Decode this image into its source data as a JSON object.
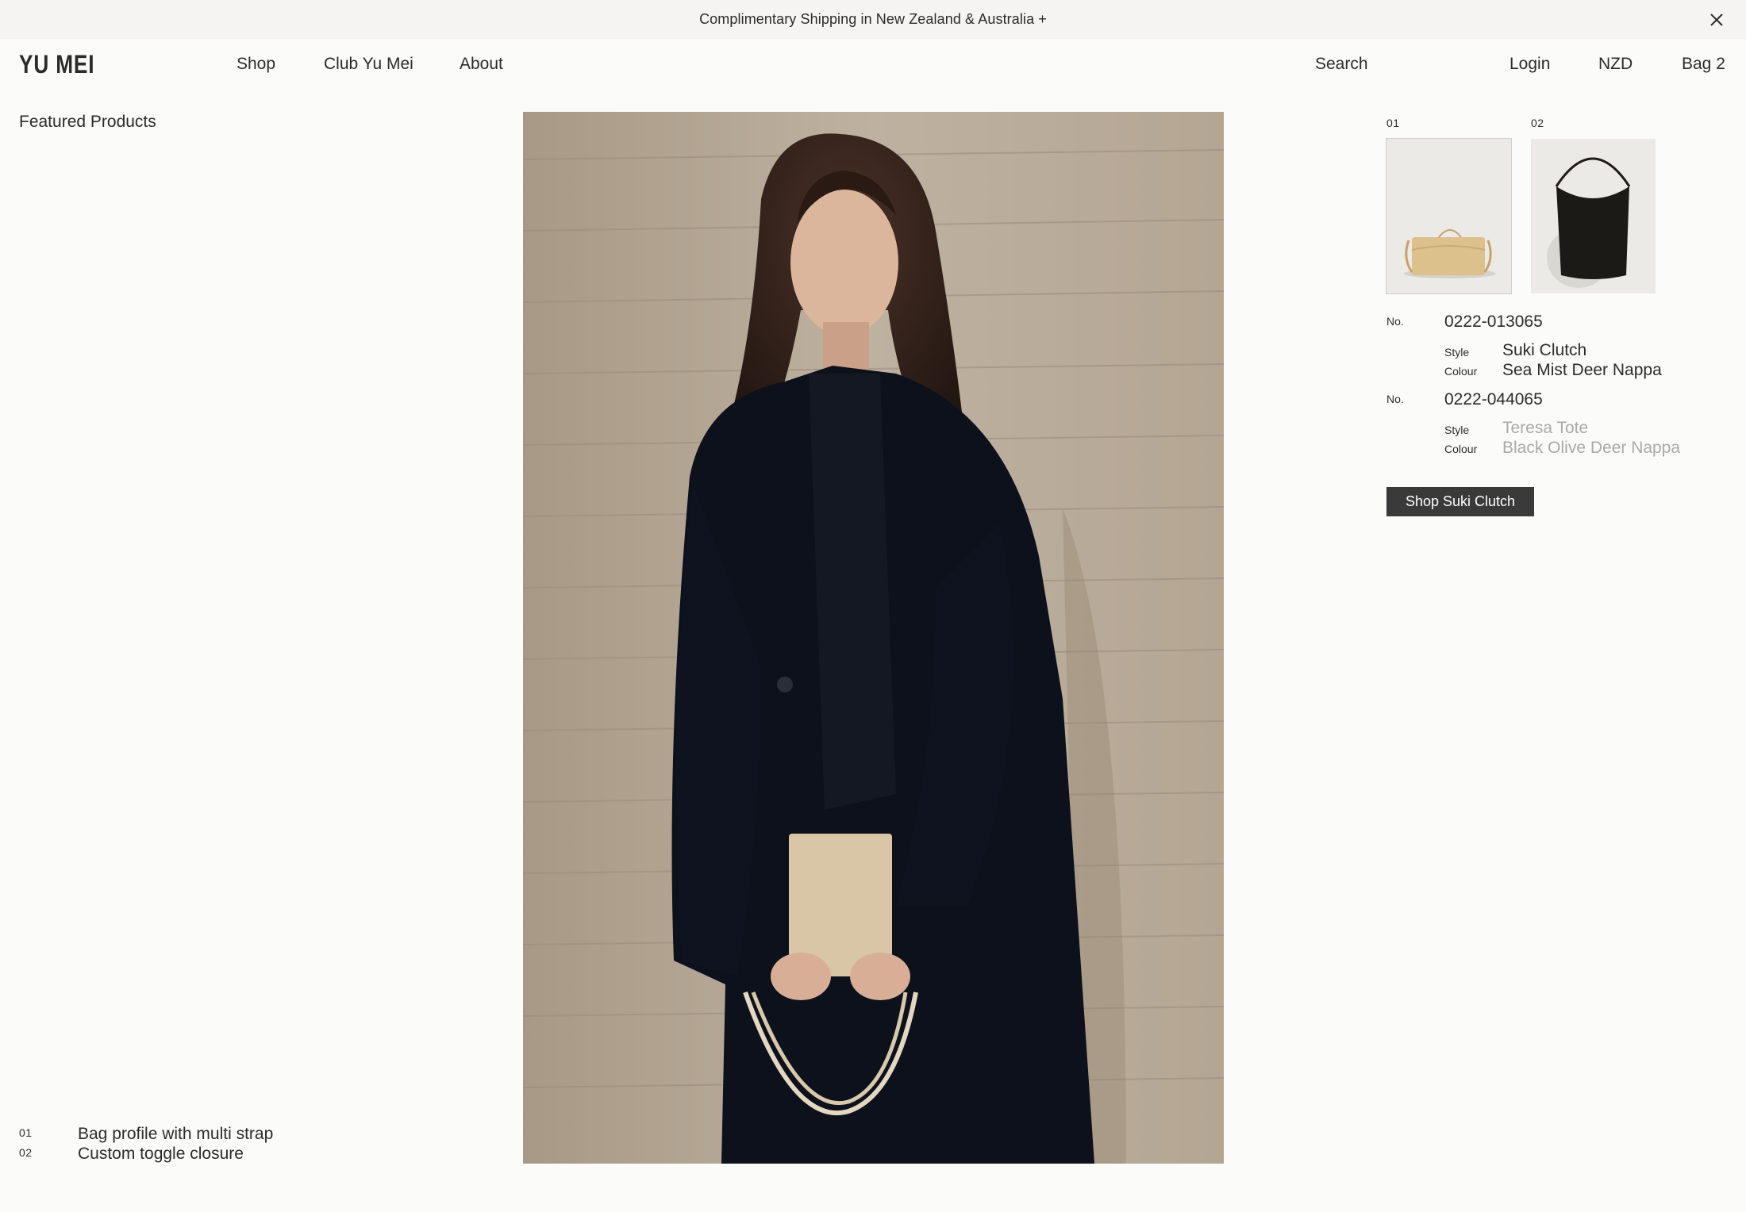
{
  "banner": {
    "text": "Complimentary Shipping in New Zealand & Australia +",
    "close_icon": "close-icon"
  },
  "nav": {
    "logo": "YU MEI",
    "links": [
      "Shop",
      "Club Yu Mei",
      "About"
    ],
    "search": "Search",
    "login": "Login",
    "currency": "NZD",
    "bag": "Bag 2"
  },
  "featured": {
    "title": "Featured Products",
    "features": [
      {
        "num": "01",
        "text": "Bag profile with multi strap"
      },
      {
        "num": "02",
        "text": "Custom toggle closure"
      }
    ]
  },
  "products": {
    "thumbnails": [
      {
        "num": "01",
        "icon": "clutch-bag-image"
      },
      {
        "num": "02",
        "icon": "tote-bag-image"
      }
    ],
    "items": [
      {
        "no_label": "No.",
        "no": "0222-013065",
        "style_label": "Style",
        "style": "Suki Clutch",
        "colour_label": "Colour",
        "colour": "Sea Mist Deer Nappa"
      },
      {
        "no_label": "No.",
        "no": "0222-044065",
        "style_label": "Style",
        "style": "Teresa Tote",
        "colour_label": "Colour",
        "colour": "Black Olive Deer Nappa"
      }
    ],
    "shop_button": "Shop Suki Clutch"
  },
  "colors": {
    "text": "#2b2b2b",
    "muted": "#a9a9a6",
    "button": "#3a3a3a",
    "banner_bg": "#f5f4f2"
  }
}
